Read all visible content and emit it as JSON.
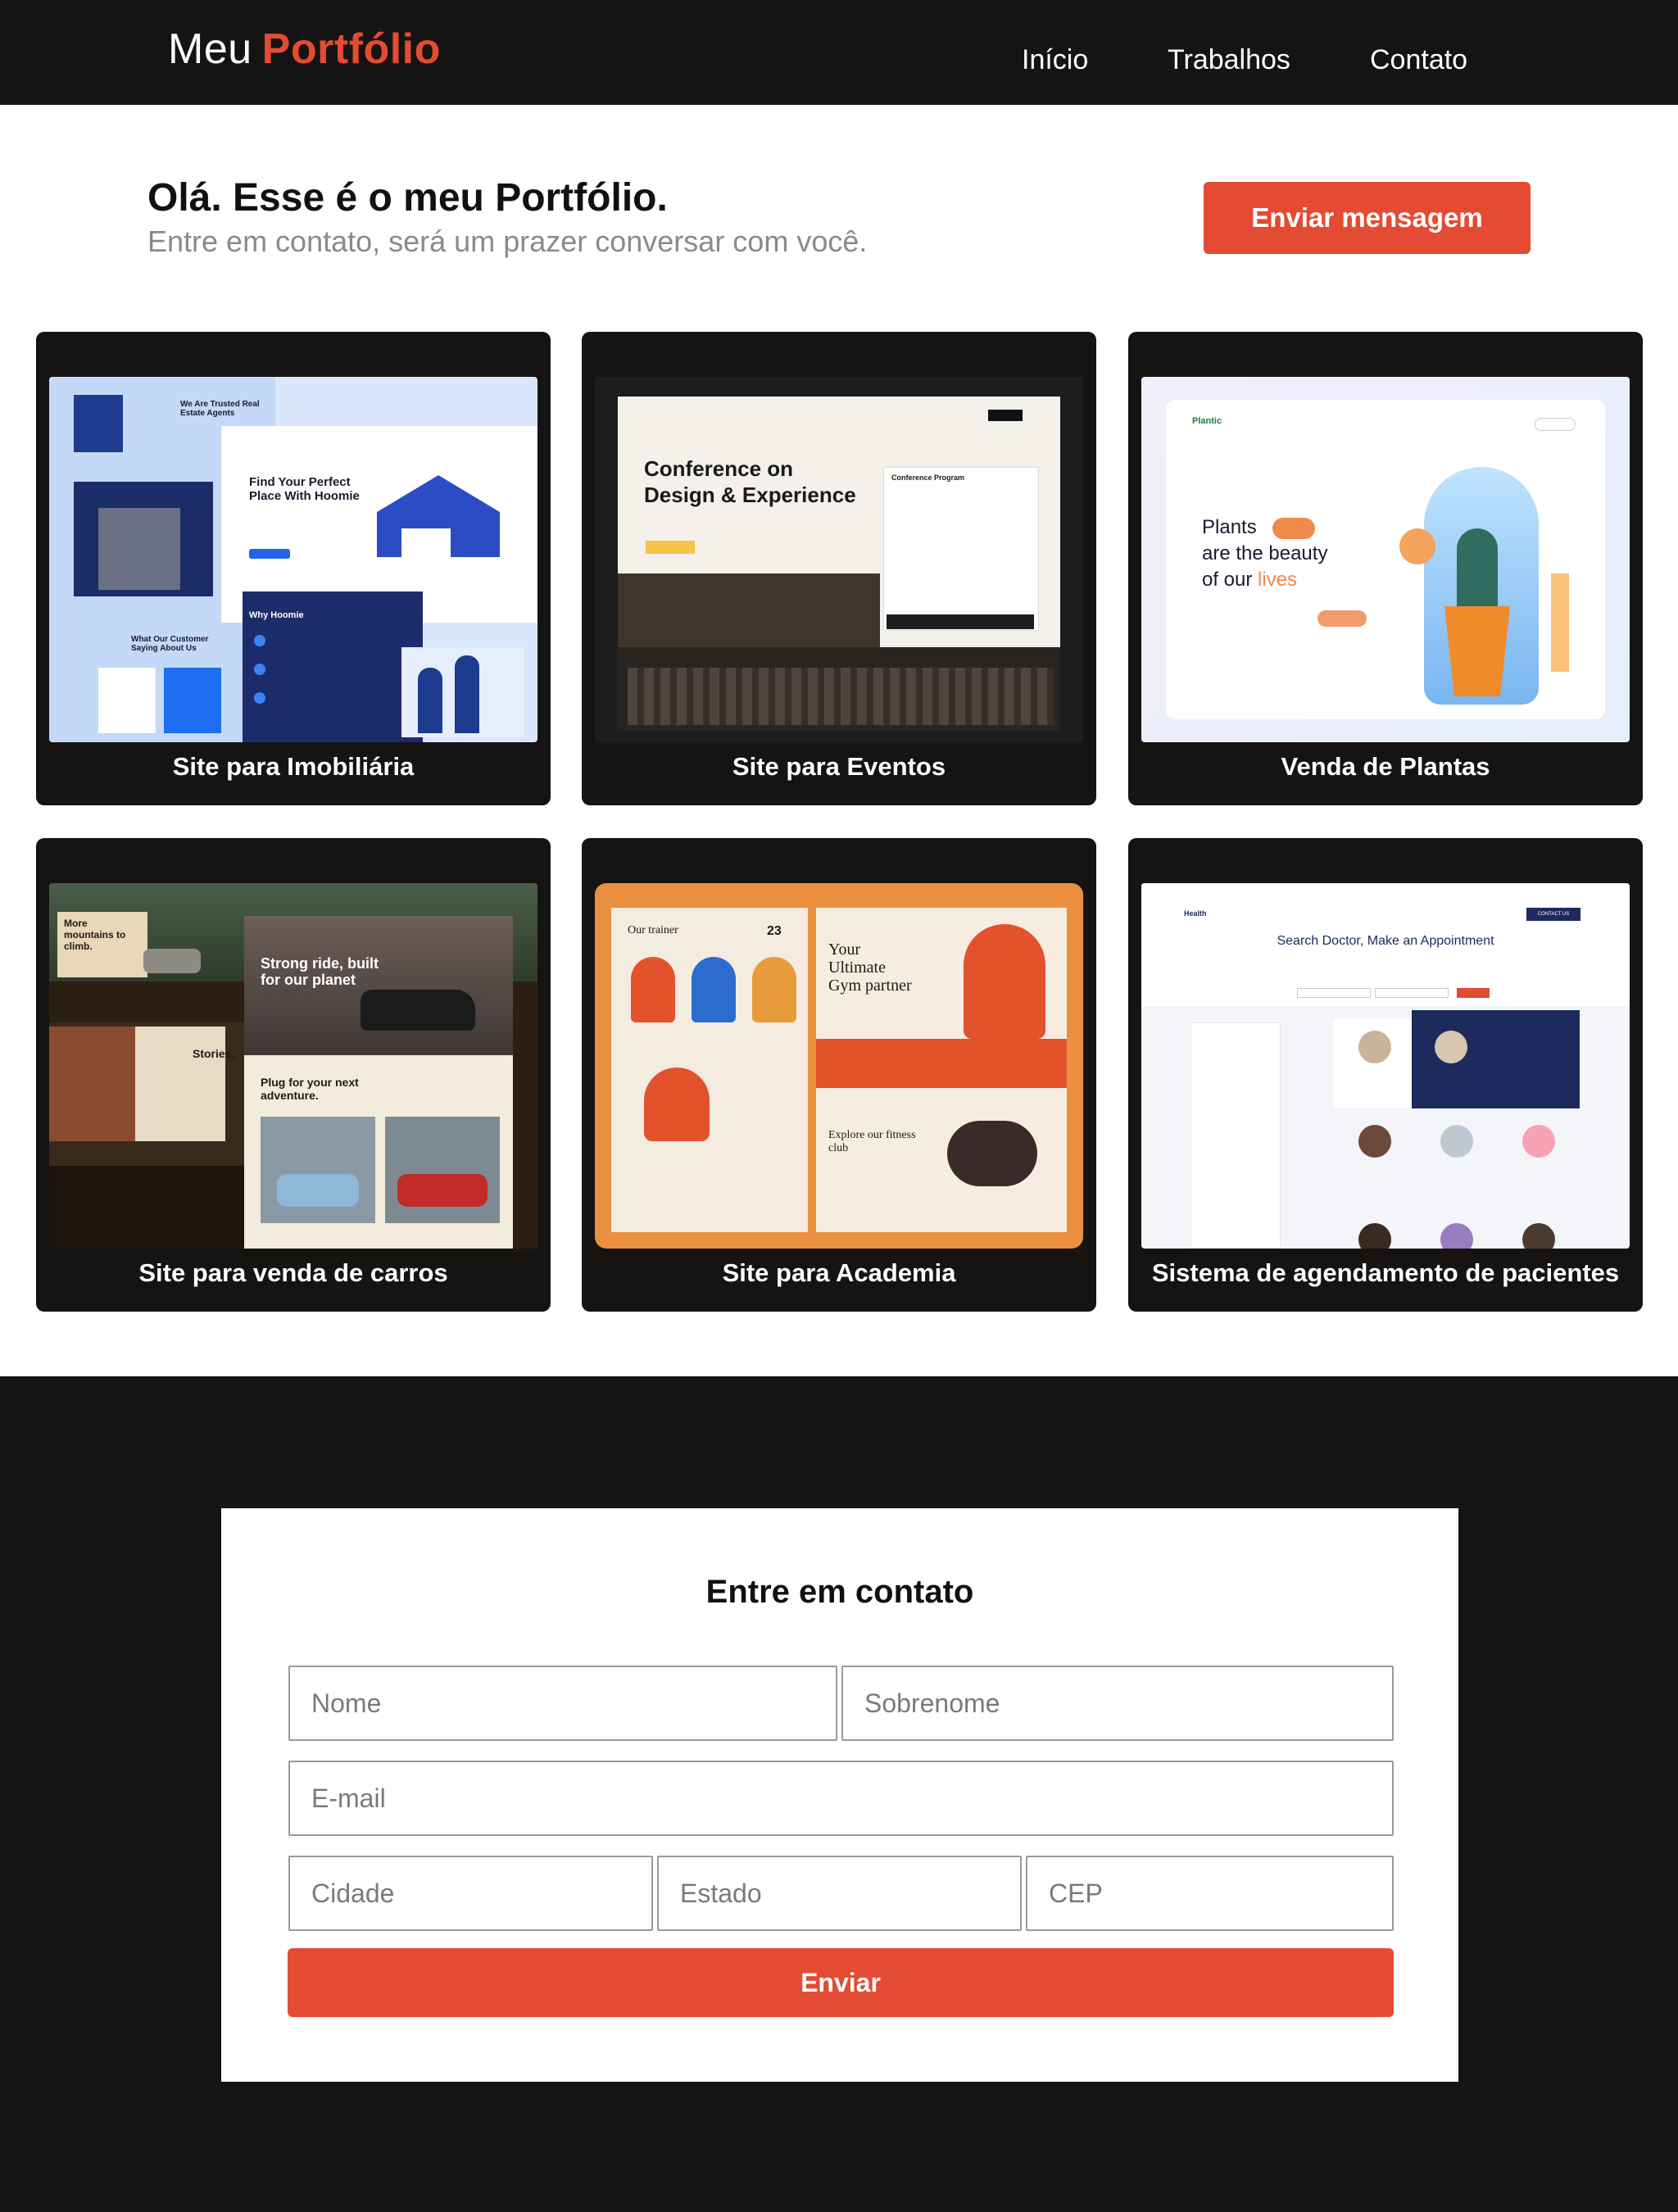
{
  "header": {
    "logo_prefix": "Meu",
    "logo_accent": "Portfólio",
    "nav": [
      "Início",
      "Trabalhos",
      "Contato"
    ]
  },
  "hero": {
    "title": "Olá. Esse é o meu Portfólio.",
    "subtitle": "Entre em contato, será um prazer conversar com você.",
    "cta_label": "Enviar mensagem"
  },
  "projects": [
    {
      "label": "Site para Imobiliária"
    },
    {
      "label": "Site para Eventos"
    },
    {
      "label": "Venda de Plantas"
    },
    {
      "label": "Site para venda de carros"
    },
    {
      "label": "Site para Academia"
    },
    {
      "label": "Sistema de agendamento de pacientes"
    }
  ],
  "thumb_text": {
    "realestate": {
      "heading": "Find Your Perfect Place With Hoomie",
      "trusted": "We Are Trusted Real Estate Agents",
      "why": "Why Hoomie",
      "testimonials": "What Our Customer Saying About Us"
    },
    "events": {
      "heading": "Conference on Design & Experience",
      "program": "Conference Program"
    },
    "plants": {
      "brand": "Plantic",
      "heading1": "Plants",
      "heading2": "are the beauty",
      "heading3": "of our",
      "accent": "lives"
    },
    "cars": {
      "tag1": "More mountains to climb.",
      "heading": "Strong ride, built for our planet",
      "stories": "Stories.",
      "plug": "Plug for your next adventure."
    },
    "gym": {
      "trainer": "Our trainer",
      "hero": "Your Ultimate Gym partner",
      "explore": "Explore our fitness club",
      "count": "23"
    },
    "doctors": {
      "brand": "Health",
      "heading": "Search Doctor, Make an Appointment",
      "cta": "CONTACT US"
    }
  },
  "contact": {
    "title": "Entre em contato",
    "placeholders": {
      "nome": "Nome",
      "sobrenome": "Sobrenome",
      "email": "E-mail",
      "cidade": "Cidade",
      "estado": "Estado",
      "cep": "CEP"
    },
    "submit_label": "Enviar"
  },
  "colors": {
    "accent": "#e44b33",
    "dark": "#151413",
    "muted_text": "#8a8a8a"
  }
}
